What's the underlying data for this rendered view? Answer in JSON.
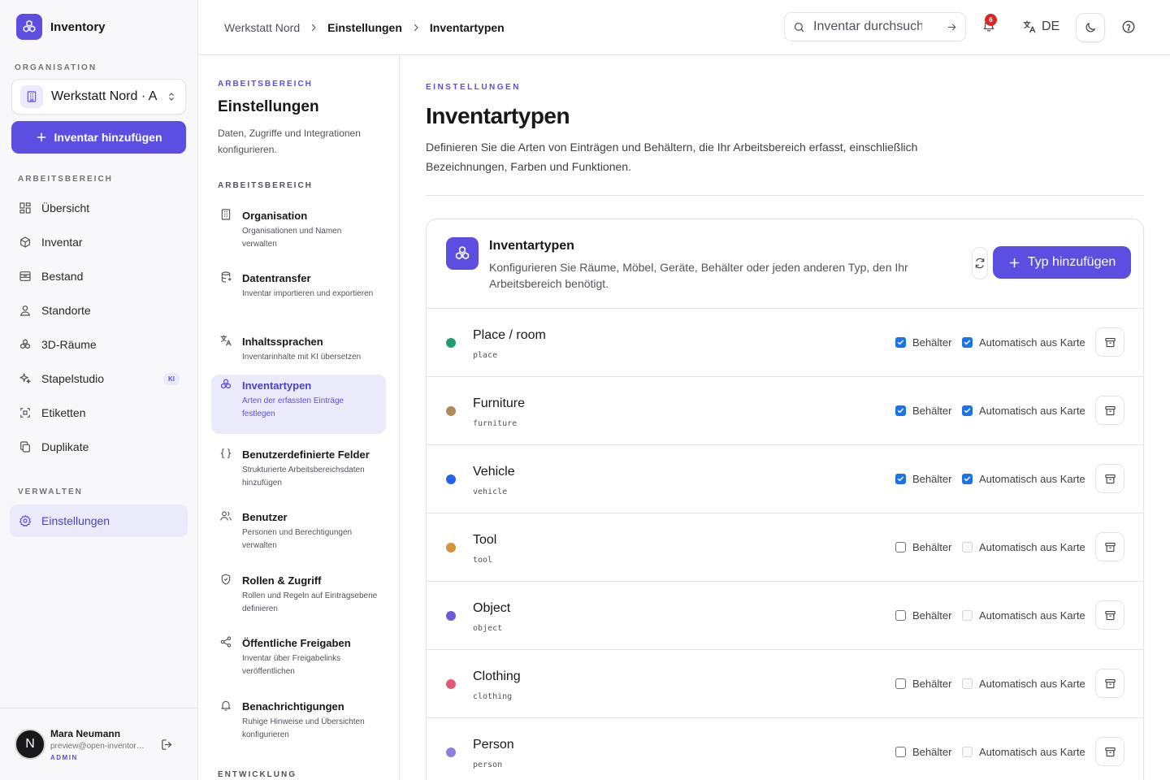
{
  "app": {
    "name": "Inventory"
  },
  "sidebar": {
    "org_section": "ORGANISATION",
    "org_name": "Werkstatt Nord · Archiv",
    "add_button": "Inventar hinzufügen",
    "workspace_section": "ARBEITSBEREICH",
    "items": [
      {
        "label": "Übersicht",
        "icon": "grid-icon"
      },
      {
        "label": "Inventar",
        "icon": "box-icon"
      },
      {
        "label": "Bestand",
        "icon": "archive-icon"
      },
      {
        "label": "Standorte",
        "icon": "person-pin-icon"
      },
      {
        "label": "3D-Räume",
        "icon": "cubes-icon"
      },
      {
        "label": "Stapelstudio",
        "icon": "sparkles-icon",
        "badge": "KI"
      },
      {
        "label": "Etiketten",
        "icon": "scan-icon"
      },
      {
        "label": "Duplikate",
        "icon": "copy-icon"
      }
    ],
    "manage_section": "VERWALTEN",
    "manage_items": [
      {
        "label": "Einstellungen",
        "icon": "gear-icon",
        "active": true
      }
    ],
    "user": {
      "initial": "N",
      "name": "Mara Neumann",
      "email": "preview@open-inventory.app",
      "role": "ADMIN"
    }
  },
  "topbar": {
    "breadcrumb": [
      "Werkstatt Nord",
      "Einstellungen",
      "Inventartypen"
    ],
    "search_placeholder": "Inventar durchsuchen",
    "notification_count": "6",
    "language": "DE"
  },
  "settings_nav": {
    "eyebrow": "ARBEITSBEREICH",
    "title": "Einstellungen",
    "description": "Daten, Zugriffe und Integrationen konfigurieren.",
    "section": "ARBEITSBEREICH",
    "items": [
      {
        "title": "Organisation",
        "desc": "Organisationen und Namen verwalten",
        "icon": "building-icon"
      },
      {
        "title": "Datentransfer",
        "desc": "Inventar importieren und exportieren",
        "icon": "database-icon"
      },
      {
        "title": "Inhaltssprachen",
        "desc": "Inventarinhalte mit KI übersetzen",
        "icon": "translate-icon"
      },
      {
        "title": "Inventartypen",
        "desc": "Arten der erfassten Einträge festlegen",
        "icon": "cubes-icon",
        "active": true
      },
      {
        "title": "Benutzerdefinierte Felder",
        "desc": "Strukturierte Arbeitsbereichsdaten hinzufügen",
        "icon": "braces-icon"
      },
      {
        "title": "Benutzer",
        "desc": "Personen und Berechtigungen verwalten",
        "icon": "users-icon"
      },
      {
        "title": "Rollen & Zugriff",
        "desc": "Rollen und Regeln auf Eintragsebene definieren",
        "icon": "shield-icon"
      },
      {
        "title": "Öffentliche Freigaben",
        "desc": "Inventar über Freigabelinks veröffentlichen",
        "icon": "share-icon"
      },
      {
        "title": "Benachrichtigungen",
        "desc": "Ruhige Hinweise und Übersichten konfigurieren",
        "icon": "bell-icon"
      }
    ],
    "section2": "ENTWICKLUNG"
  },
  "content": {
    "eyebrow": "EINSTELLUNGEN",
    "title": "Inventartypen",
    "description": "Definieren Sie die Arten von Einträgen und Behältern, die Ihr Arbeitsbereich erfasst, einschließlich Bezeichnungen, Farben und Funktionen.",
    "card": {
      "title": "Inventartypen",
      "description": "Konfigurieren Sie Räume, Möbel, Geräte, Behälter oder jeden anderen Typ, den Ihr Arbeitsbereich benötigt.",
      "add_button": "Typ hinzufügen",
      "container_label": "Behälter",
      "auto_label": "Automatisch aus Karte",
      "types": [
        {
          "name": "Place / room",
          "key": "place",
          "color": "#1f9e6e",
          "container": true,
          "auto": true
        },
        {
          "name": "Furniture",
          "key": "furniture",
          "color": "#b08a5a",
          "container": true,
          "auto": true
        },
        {
          "name": "Vehicle",
          "key": "vehicle",
          "color": "#2563eb",
          "container": true,
          "auto": true
        },
        {
          "name": "Tool",
          "key": "tool",
          "color": "#d4943c",
          "container": false,
          "auto": false
        },
        {
          "name": "Object",
          "key": "object",
          "color": "#6d5bd6",
          "container": false,
          "auto": false
        },
        {
          "name": "Clothing",
          "key": "clothing",
          "color": "#e05a78",
          "container": false,
          "auto": false
        },
        {
          "name": "Person",
          "key": "person",
          "color": "#8b7fe0",
          "container": false,
          "auto": false
        }
      ]
    }
  },
  "colors": {
    "accent": "#5b4ee0",
    "accent_soft": "#ebeafb",
    "checkbox": "#1a73e8",
    "danger": "#dc2626"
  }
}
